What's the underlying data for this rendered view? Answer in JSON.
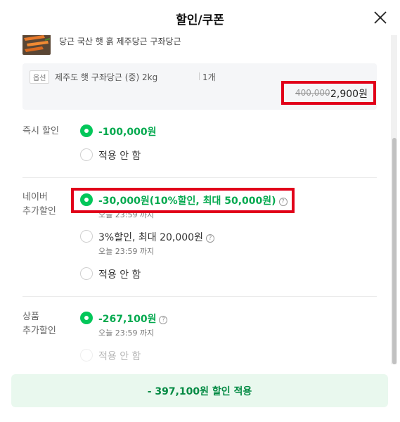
{
  "header": {
    "title": "할인/쿠폰"
  },
  "product": {
    "name": "당근 국산 햇 흙 제주당근 구좌당근",
    "option_badge": "옵션",
    "option_text": "제주도 햇 구좌당근 (중) 2kg",
    "quantity": "1개",
    "original_price": "400,000",
    "final_price": "2,900원"
  },
  "sections": {
    "instant": {
      "label": "즉시 할인",
      "options": [
        {
          "text": "-100,000원",
          "selected": true
        },
        {
          "text": "적용 안 함",
          "selected": false
        }
      ]
    },
    "naver": {
      "label_line1": "네이버",
      "label_line2": "추가할인",
      "options": [
        {
          "text": "-30,000원(10%할인, 최대 50,000원)",
          "sub": "오늘 23:59 까지",
          "selected": true
        },
        {
          "text": "3%할인, 최대 20,000원",
          "sub": "오늘 23:59 까지",
          "selected": false
        },
        {
          "text": "적용 안 함",
          "selected": false
        }
      ]
    },
    "product_extra": {
      "label_line1": "상품",
      "label_line2": "추가할인",
      "options": [
        {
          "text": "-267,100원",
          "sub": "오늘 23:59 까지",
          "selected": true
        },
        {
          "text": "적용 안 함",
          "selected": false
        }
      ]
    }
  },
  "footer": {
    "apply_label": "- 397,100원 할인 적용"
  },
  "colors": {
    "accent_green": "#03c75a",
    "highlight_red": "#e1001a",
    "button_bg": "#e9f8ee"
  }
}
